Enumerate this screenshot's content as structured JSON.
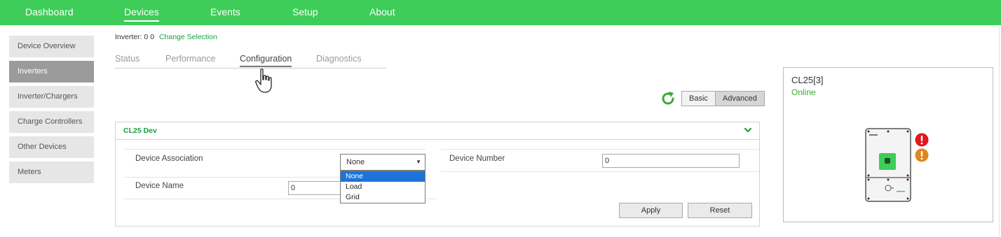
{
  "nav": {
    "items": [
      "Dashboard",
      "Devices",
      "Events",
      "Setup",
      "About"
    ],
    "active_index": 1,
    "color": "#3dcd58"
  },
  "sidebar": {
    "items": [
      "Device Overview",
      "Inverters",
      "Inverter/Chargers",
      "Charge Controllers",
      "Other Devices",
      "Meters"
    ],
    "active_index": 1
  },
  "selection": {
    "label": "Inverter: 0 0",
    "link": "Change Selection"
  },
  "tabs": {
    "items": [
      "Status",
      "Performance",
      "Configuration",
      "Diagnostics"
    ],
    "active_index": 2
  },
  "mode": {
    "basic": "Basic",
    "advanced": "Advanced",
    "active": "Advanced"
  },
  "panel": {
    "title": "CL25 Dev",
    "device_association": {
      "label": "Device Association",
      "value": "None",
      "options": [
        "None",
        "Load",
        "Grid"
      ],
      "highlighted_index": 0
    },
    "device_number": {
      "label": "Device Number",
      "value": "0"
    },
    "device_name": {
      "label": "Device Name",
      "value": "0"
    },
    "apply": "Apply",
    "reset": "Reset"
  },
  "device_card": {
    "name": "CL25[3]",
    "status": "Online",
    "status_color": "#3aaa35",
    "alerts": [
      "error-icon",
      "warning-icon"
    ]
  }
}
